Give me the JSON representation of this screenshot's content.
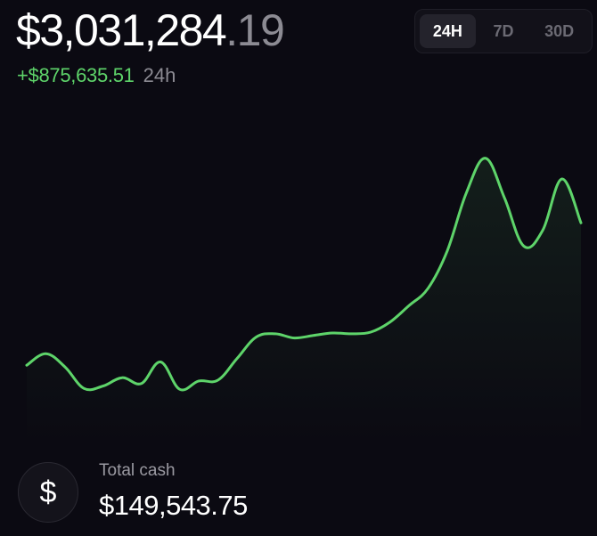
{
  "portfolio": {
    "balance_main": "$3,031,284",
    "balance_cents": ".19",
    "change_amount": "+$875,635.51",
    "change_period": "24h"
  },
  "range_tabs": [
    {
      "label": "24H",
      "active": true
    },
    {
      "label": "7D",
      "active": false
    },
    {
      "label": "30D",
      "active": false
    }
  ],
  "cash": {
    "label": "Total cash",
    "value": "$149,543.75",
    "icon": "dollar-icon",
    "icon_glyph": "$"
  },
  "colors": {
    "background": "#0b0a12",
    "accent_green": "#5ed46a",
    "muted_text": "#8c8b93"
  },
  "chart_data": {
    "type": "line",
    "grid": false,
    "series": [
      {
        "values": [
          1.2,
          2.6,
          1.0,
          -1.6,
          -1.3,
          -0.3,
          -1.0,
          1.6,
          -1.7,
          -0.7,
          -0.6,
          2.0,
          4.6,
          5.0,
          4.5,
          4.8,
          5.1,
          5.0,
          5.2,
          6.4,
          8.4,
          10.5,
          15.0,
          22.0,
          26.2,
          21.4,
          15.6,
          17.5,
          23.7,
          18.4
        ]
      }
    ]
  }
}
